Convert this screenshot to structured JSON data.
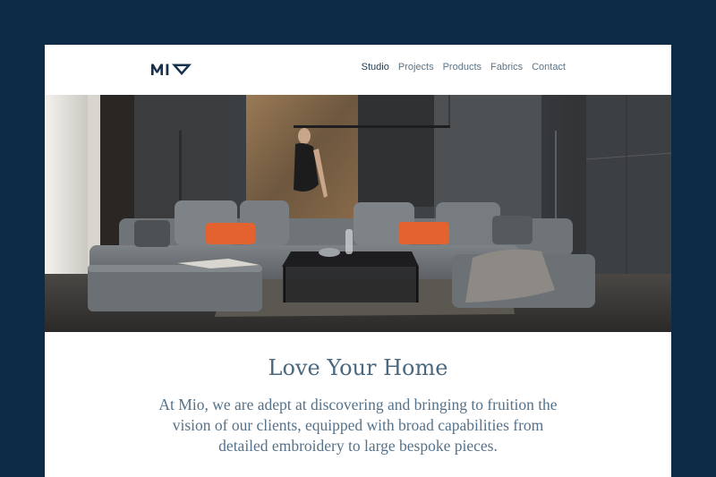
{
  "brand": {
    "logo_text": "MIO",
    "logo_color": "#17324d"
  },
  "nav": {
    "items": [
      {
        "label": "Studio",
        "active": true
      },
      {
        "label": "Projects",
        "active": false
      },
      {
        "label": "Products",
        "active": false
      },
      {
        "label": "Fabrics",
        "active": false
      },
      {
        "label": "Contact",
        "active": false
      }
    ]
  },
  "hero": {
    "image_icon": "living-room-photo"
  },
  "main": {
    "title": "Love Your Home",
    "description": "At Mio, we are adept at discovering and bringing to fruition the vision of our clients, equipped with broad capabilities from detailed embroidery to large bespoke pieces."
  },
  "colors": {
    "background": "#0d2a47",
    "panel": "#ffffff",
    "text": "#4b687e",
    "accent_cushion": "#e4622e"
  }
}
